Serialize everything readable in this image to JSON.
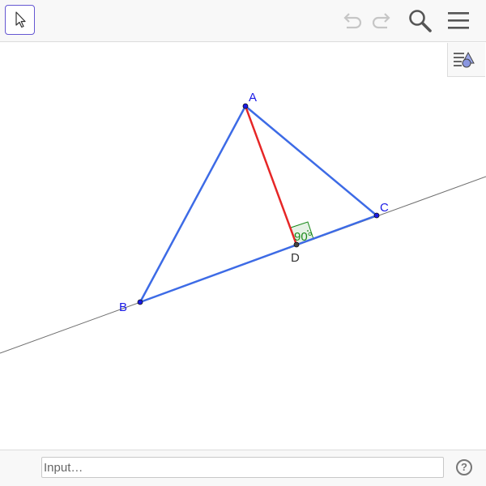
{
  "colors": {
    "point": "#1a1ae6",
    "triangle": "#3d6be6",
    "altitude": "#e62626",
    "angle": "#1a8a1a",
    "line": "#6e6e6e",
    "accent": "#6557d2"
  },
  "toolbar": {
    "tool_icon": "move-arrow-icon",
    "undo_icon": "undo-icon",
    "redo_icon": "redo-icon",
    "search_icon": "search-icon",
    "menu_icon": "hamburger-menu-icon"
  },
  "algebra_toggle": {
    "icon": "algebra-view-icon"
  },
  "construction": {
    "points": [
      {
        "name": "A",
        "label": "A"
      },
      {
        "name": "B",
        "label": "B"
      },
      {
        "name": "C",
        "label": "C"
      },
      {
        "name": "D",
        "label": "D"
      }
    ],
    "angle_label": "90°"
  },
  "input_bar": {
    "placeholder": "Input…",
    "help_label": "?"
  }
}
